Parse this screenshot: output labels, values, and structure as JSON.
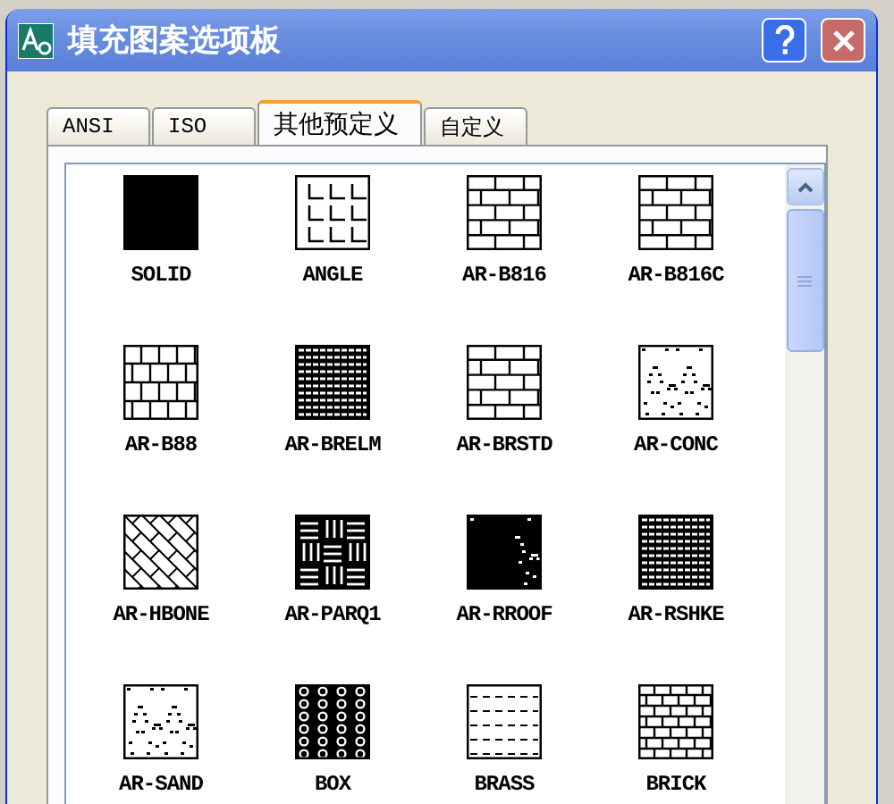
{
  "window": {
    "title": "填充图案选项板"
  },
  "tabs": [
    {
      "label": "ANSI",
      "selected": false
    },
    {
      "label": "ISO",
      "selected": false
    },
    {
      "label": "其他预定义",
      "selected": true
    },
    {
      "label": "自定义",
      "selected": false
    }
  ],
  "patterns": [
    {
      "name": "SOLID",
      "kind": "solid",
      "selected": false
    },
    {
      "name": "ANGLE",
      "kind": "angle",
      "selected": false
    },
    {
      "name": "AR-B816",
      "kind": "brick",
      "selected": false
    },
    {
      "name": "AR-B816C",
      "kind": "brick",
      "selected": false
    },
    {
      "name": "AR-B88",
      "kind": "block",
      "selected": false
    },
    {
      "name": "AR-BRELM",
      "kind": "dense",
      "selected": false
    },
    {
      "name": "AR-BRSTD",
      "kind": "brick",
      "selected": false
    },
    {
      "name": "AR-CONC",
      "kind": "speckle",
      "selected": false
    },
    {
      "name": "AR-HBONE",
      "kind": "herringbone",
      "selected": false
    },
    {
      "name": "AR-PARQ1",
      "kind": "parquet",
      "selected": false
    },
    {
      "name": "AR-RROOF",
      "kind": "dots",
      "selected": false
    },
    {
      "name": "AR-RSHKE",
      "kind": "dense",
      "selected": false
    },
    {
      "name": "AR-SAND",
      "kind": "sand",
      "selected": false
    },
    {
      "name": "BOX",
      "kind": "box",
      "selected": false
    },
    {
      "name": "BRASS",
      "kind": "dashes",
      "selected": false
    },
    {
      "name": "BRICK",
      "kind": "smallbrick",
      "selected": false
    }
  ]
}
